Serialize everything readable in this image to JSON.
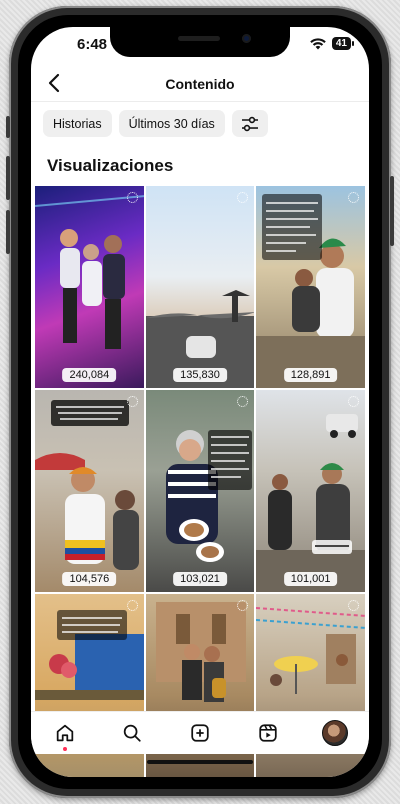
{
  "status_bar": {
    "time": "6:48",
    "battery": "41"
  },
  "header": {
    "title": "Contenido"
  },
  "filters": [
    {
      "label": "Historias"
    },
    {
      "label": "Últimos 30 días"
    }
  ],
  "section": {
    "title": "Visualizaciones"
  },
  "tiles": [
    {
      "views": "240,084"
    },
    {
      "views": "135,830"
    },
    {
      "views": "128,891"
    },
    {
      "views": "104,576"
    },
    {
      "views": "103,021"
    },
    {
      "views": "101,001"
    },
    {
      "views": ""
    },
    {
      "views": ""
    },
    {
      "views": ""
    }
  ],
  "bottom_nav": [
    "home-icon",
    "search-icon",
    "create-icon",
    "reels-icon",
    "profile-avatar"
  ]
}
